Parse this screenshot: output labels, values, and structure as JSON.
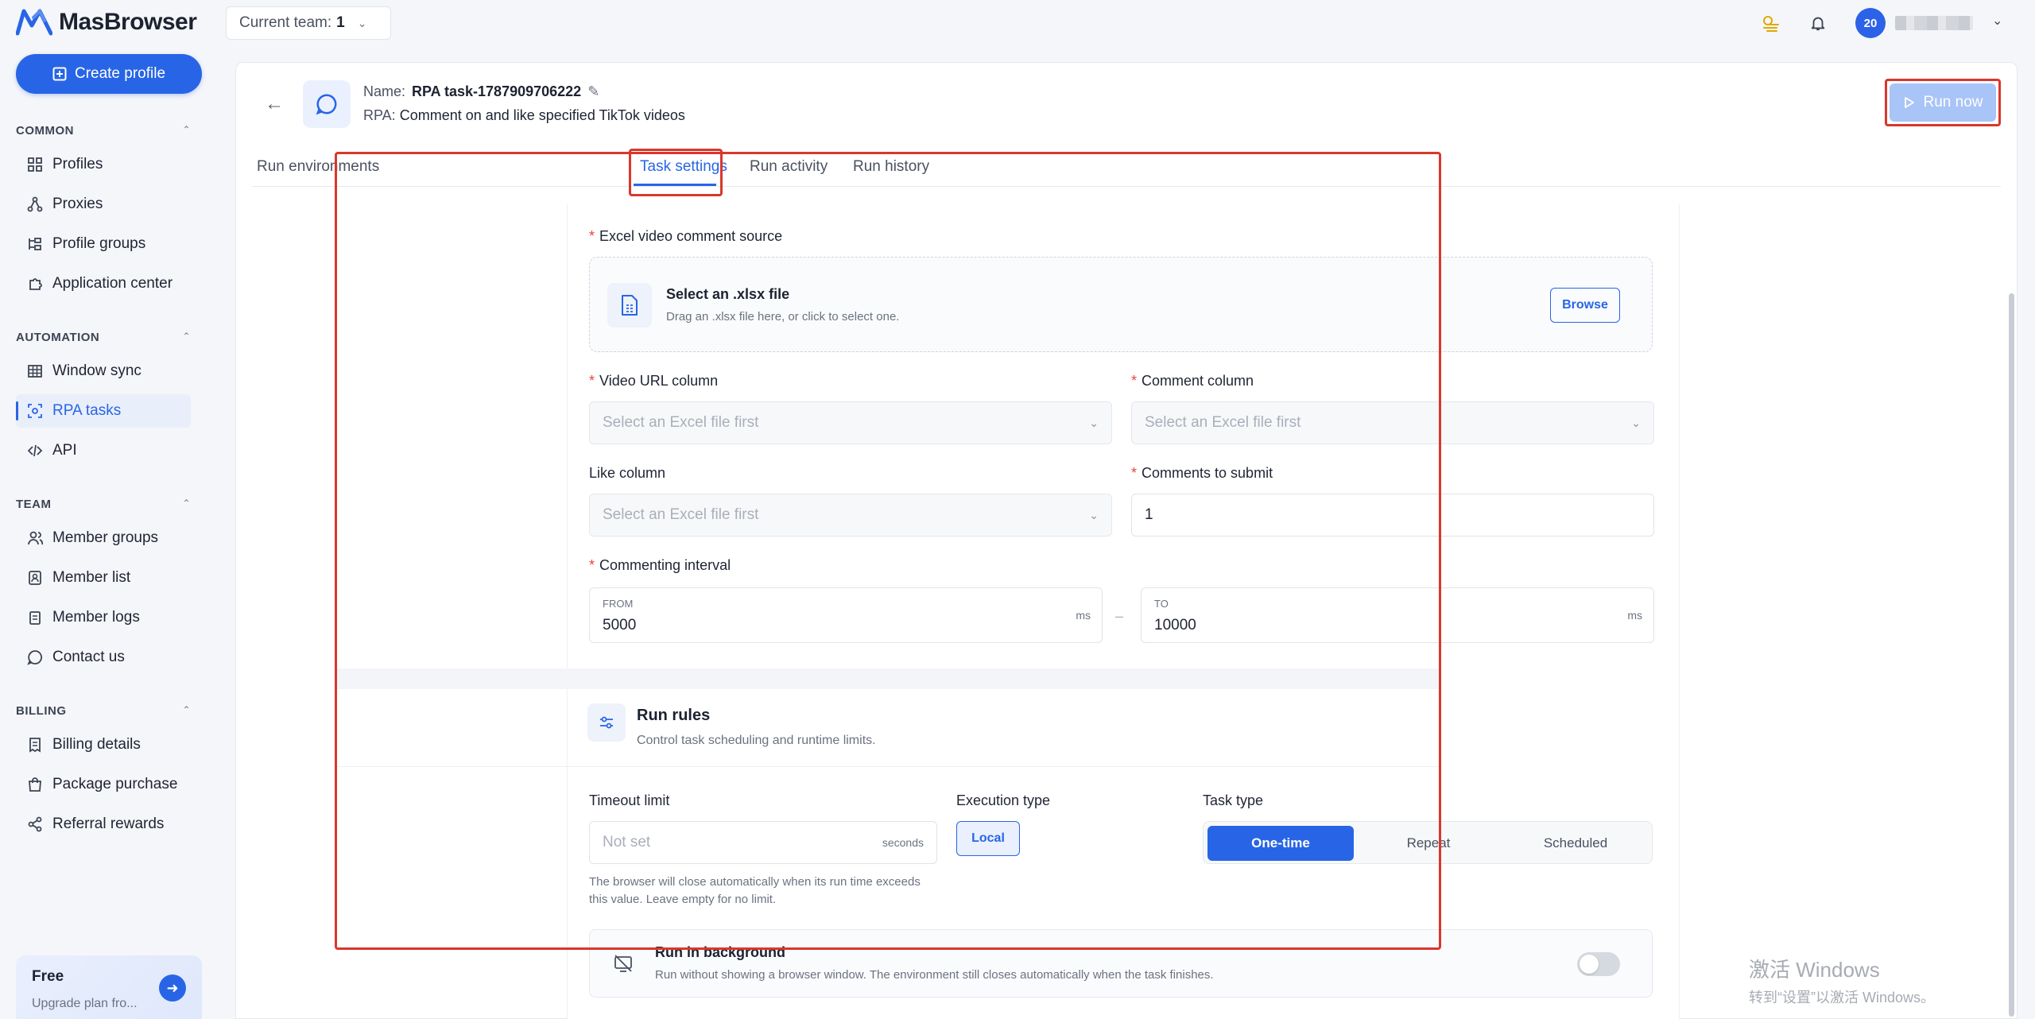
{
  "app": {
    "logo_text": "MasBrowser",
    "brand_color": "#2865e6"
  },
  "header": {
    "team_label": "Current team:",
    "team_value": "1",
    "avatar_initials": "20"
  },
  "sidebar": {
    "create_profile": "Create profile",
    "sections": {
      "common": "COMMON",
      "automation": "AUTOMATION",
      "team": "TEAM",
      "billing": "BILLING"
    },
    "items": {
      "profiles": "Profiles",
      "proxies": "Proxies",
      "profile_groups": "Profile groups",
      "application_center": "Application center",
      "window_sync": "Window sync",
      "rpa_tasks": "RPA tasks",
      "api": "API",
      "member_groups": "Member groups",
      "member_list": "Member list",
      "member_logs": "Member logs",
      "contact_us": "Contact us",
      "billing_details": "Billing details",
      "package_purchase": "Package purchase",
      "referral_rewards": "Referral rewards"
    },
    "plan": {
      "title": "Free",
      "subtitle": "Upgrade plan fro..."
    }
  },
  "task": {
    "name_label": "Name:",
    "name": "RPA task-1787909706222",
    "rpa_label": "RPA:",
    "rpa": "Comment on and like specified TikTok videos",
    "run_now": "Run now"
  },
  "tabs": {
    "run_environments": "Run environments",
    "task_settings": "Task settings",
    "run_activity": "Run activity",
    "run_history": "Run history"
  },
  "form": {
    "excel_source_label": "Excel video comment source",
    "dropzone_title": "Select an .xlsx file",
    "dropzone_sub": "Drag an .xlsx file here, or click to select one.",
    "browse": "Browse",
    "video_url_label": "Video URL column",
    "comment_label": "Comment column",
    "like_label": "Like column",
    "comments_submit_label": "Comments to submit",
    "select_placeholder": "Select an Excel file first",
    "comments_submit_value": "1",
    "interval_label": "Commenting interval",
    "from_label": "FROM",
    "from_value": "5000",
    "to_label": "TO",
    "to_value": "10000",
    "unit_ms": "ms",
    "dash": "–"
  },
  "run_rules": {
    "title": "Run rules",
    "subtitle": "Control task scheduling and runtime limits.",
    "timeout_label": "Timeout limit",
    "timeout_placeholder": "Not set",
    "timeout_unit": "seconds",
    "timeout_help": "The browser will close automatically when its run time exceeds this value. Leave empty for no limit.",
    "execution_label": "Execution type",
    "execution_value": "Local",
    "task_type_label": "Task type",
    "task_types": [
      "One-time",
      "Repeat",
      "Scheduled"
    ],
    "background_title": "Run in background",
    "background_sub": "Run without showing a browser window. The environment still closes automatically when the task finishes."
  },
  "watermark": {
    "line1": "激活 Windows",
    "line2": "转到“设置”以激活 Windows。"
  }
}
